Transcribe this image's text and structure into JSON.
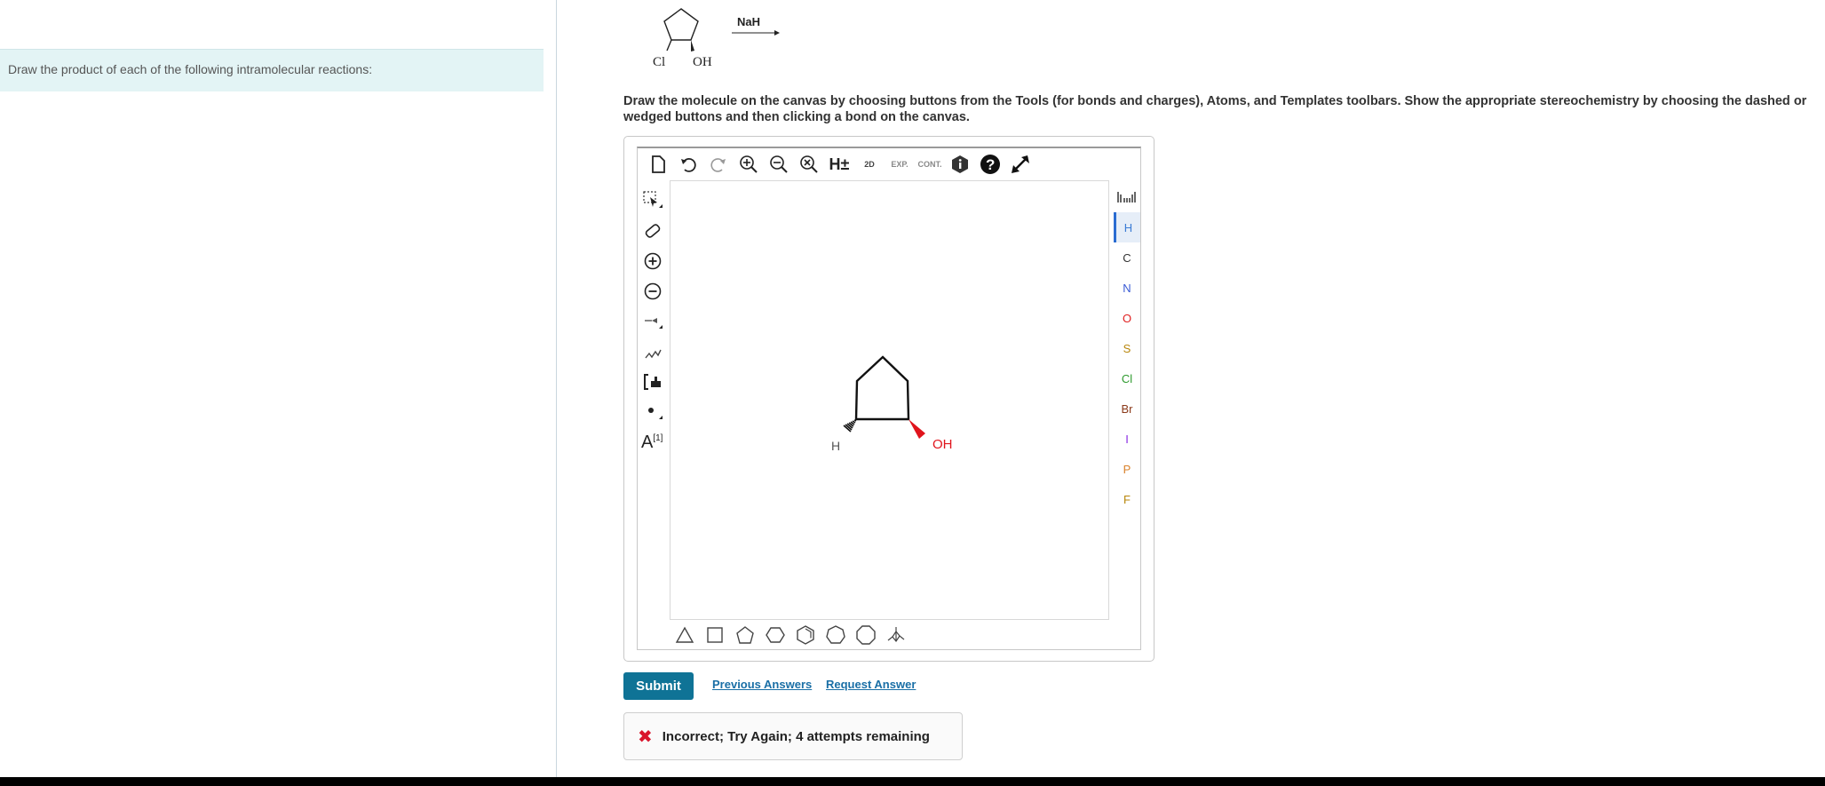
{
  "prompt": {
    "text": "Draw the product of each of the following intramolecular reactions:"
  },
  "scheme": {
    "substituent_left": "Cl",
    "substituent_right": "OH",
    "reagent": "NaH"
  },
  "instructions": "Draw the molecule on the canvas by choosing buttons from the Tools (for bonds and charges), Atoms, and Templates toolbars. Show the appropriate stereochemistry by choosing the dashed or wedged buttons and then clicking a bond on the canvas.",
  "editor": {
    "top_tools": {
      "h_label": "H±",
      "twod_label": "2D",
      "exp_label": "EXP.",
      "cont_label": "CONT."
    },
    "charge_label": "[1]",
    "atom_label": "A",
    "atoms": [
      {
        "symbol": "H",
        "color": "#3a7bd5"
      },
      {
        "symbol": "C",
        "color": "#333333"
      },
      {
        "symbol": "N",
        "color": "#3a5bd5"
      },
      {
        "symbol": "O",
        "color": "#e02020"
      },
      {
        "symbol": "S",
        "color": "#b8860b"
      },
      {
        "symbol": "Cl",
        "color": "#2e9a2e"
      },
      {
        "symbol": "Br",
        "color": "#8b3a1a"
      },
      {
        "symbol": "I",
        "color": "#8a2be2"
      },
      {
        "symbol": "P",
        "color": "#d9822b"
      },
      {
        "symbol": "F",
        "color": "#b8860b"
      }
    ],
    "molecule": {
      "h_label": "H",
      "oh_label": "OH"
    }
  },
  "actions": {
    "submit": "Submit",
    "previous_answers": "Previous Answers",
    "request_answer": "Request Answer"
  },
  "feedback": {
    "icon": "✖",
    "message": "Incorrect; Try Again; 4 attempts remaining"
  },
  "colors": {
    "accent": "#0f7396",
    "link": "#1a6fa6",
    "error": "#d9152c",
    "prompt_bg": "#e3f4f5"
  }
}
